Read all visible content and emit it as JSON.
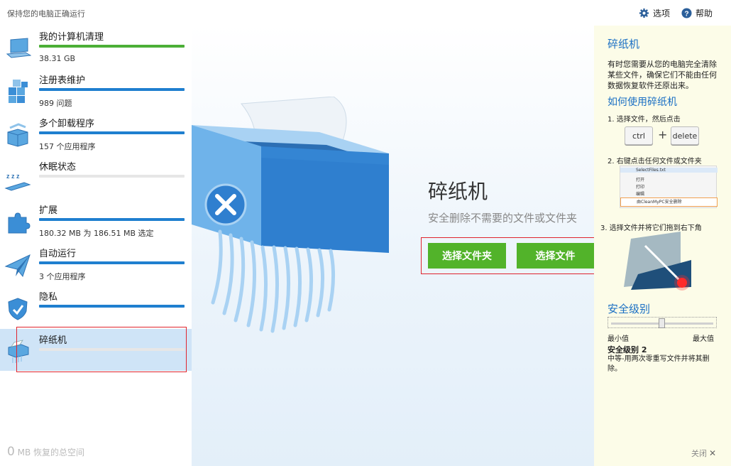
{
  "header": {
    "tagline": "保持您的电脑正确运行",
    "options_label": "选项",
    "help_label": "帮助"
  },
  "sidebar": {
    "items": [
      {
        "label": "我的计算机清理",
        "sub": "38.31 GB",
        "progress": 1.0,
        "bar_color": "#4caf37",
        "icon": "laptop-icon"
      },
      {
        "label": "注册表维护",
        "sub": "989 问题",
        "progress": 1.0,
        "bar_color": "#1f7fcf",
        "icon": "registry-cubes-icon"
      },
      {
        "label": "多个卸载程序",
        "sub": "157 个应用程序",
        "progress": 1.0,
        "bar_color": "#1f7fcf",
        "icon": "uninstall-box-icon"
      },
      {
        "label": "休眠状态",
        "sub": "",
        "progress": 0,
        "bar_color": "#1f7fcf",
        "icon": "sleep-icon"
      },
      {
        "label": "扩展",
        "sub": "180.32 MB 为 186.51 MB 选定",
        "progress": 1.0,
        "bar_color": "#1f7fcf",
        "icon": "puzzle-icon"
      },
      {
        "label": "自动运行",
        "sub": "3 个应用程序",
        "progress": 1.0,
        "bar_color": "#1f7fcf",
        "icon": "paper-plane-icon"
      },
      {
        "label": "隐私",
        "sub": "",
        "progress": 1.0,
        "bar_color": "#1f7fcf",
        "icon": "shield-icon"
      },
      {
        "label": "碎纸机",
        "sub": "",
        "progress": 0,
        "bar_color": "#1f7fcf",
        "icon": "shredder-icon"
      }
    ],
    "footer_number": "0",
    "footer_text": "MB 恢复的总空间"
  },
  "main": {
    "title": "碎纸机",
    "subtitle": "安全删除不需要的文件或文件夹",
    "select_folder_btn": "选择文件夹",
    "select_file_btn": "选择文件"
  },
  "help": {
    "title": "碎纸机",
    "description": "有时您需要从您的电脑完全清除某些文件，确保它们不能由任何数据恢复软件还原出来。",
    "howto_title": "如何使用碎纸机",
    "step1": "1. 选择文件，然后点击",
    "key_ctrl": "ctrl",
    "key_plus": "+",
    "key_delete": "delete",
    "step2": "2. 右键点击任何文件或文件夹",
    "context_menu": {
      "filename": "SelectFiles.txt",
      "items": [
        "打开",
        "打印",
        "编辑"
      ],
      "selected": "由CleanMyPC安全删除"
    },
    "step3": "3. 选择文件并将它们拖到右下角",
    "security_title": "安全级别",
    "slider_value": 0.5,
    "min_label": "最小值",
    "max_label": "最大值",
    "level_label": "安全级别 2",
    "level_desc": "中等-用两次零重写文件并将其删除。",
    "close_label": "关闭"
  }
}
